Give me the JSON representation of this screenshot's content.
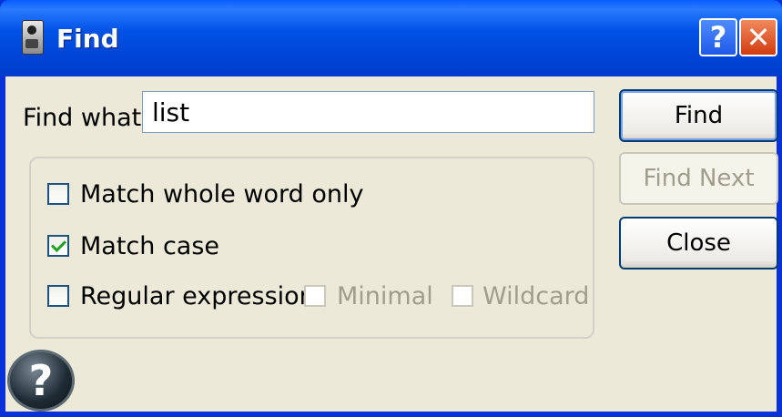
{
  "window": {
    "title": "Find",
    "help_button": "?",
    "close_button": "✕"
  },
  "find": {
    "label": "Find what:",
    "value": "list"
  },
  "options": {
    "whole_word": {
      "label": "Match whole word only",
      "checked": false
    },
    "match_case": {
      "label": "Match case",
      "checked": true
    },
    "regex": {
      "label": "Regular expression",
      "checked": false
    },
    "minimal": {
      "label": "Minimal",
      "checked": false,
      "enabled": false
    },
    "wildcard": {
      "label": "Wildcard",
      "checked": false,
      "enabled": false
    }
  },
  "buttons": {
    "find": "Find",
    "find_next": "Find Next",
    "close": "Close"
  },
  "help_icon": {
    "glyph": "?",
    "icon": "help-circle-icon"
  },
  "colors": {
    "titlebar": "#0054e3",
    "client": "#ece9d8",
    "check_mark": "#21a121"
  }
}
